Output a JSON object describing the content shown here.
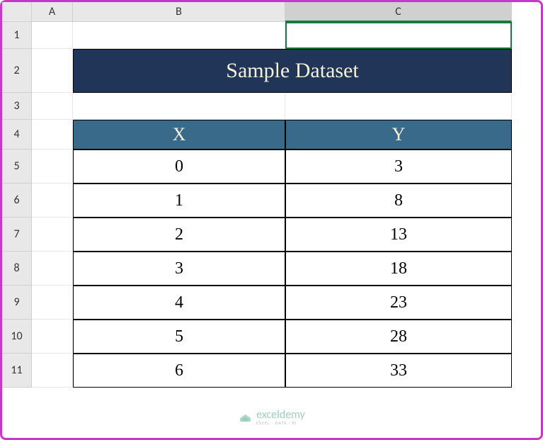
{
  "columns": [
    "A",
    "B",
    "C"
  ],
  "rows": [
    "1",
    "2",
    "3",
    "4",
    "5",
    "6",
    "7",
    "8",
    "9",
    "10",
    "11"
  ],
  "selected_column": "C",
  "title": "Sample Dataset",
  "table_headers": {
    "x": "X",
    "y": "Y"
  },
  "chart_data": {
    "type": "table",
    "columns": [
      "X",
      "Y"
    ],
    "data": [
      {
        "x": 0,
        "y": 3
      },
      {
        "x": 1,
        "y": 8
      },
      {
        "x": 2,
        "y": 13
      },
      {
        "x": 3,
        "y": 18
      },
      {
        "x": 4,
        "y": 23
      },
      {
        "x": 5,
        "y": 28
      },
      {
        "x": 6,
        "y": 33
      }
    ],
    "title": "Sample Dataset"
  },
  "watermark": {
    "title": "exceldemy",
    "subtitle": "EXCEL · DATA · BI"
  }
}
